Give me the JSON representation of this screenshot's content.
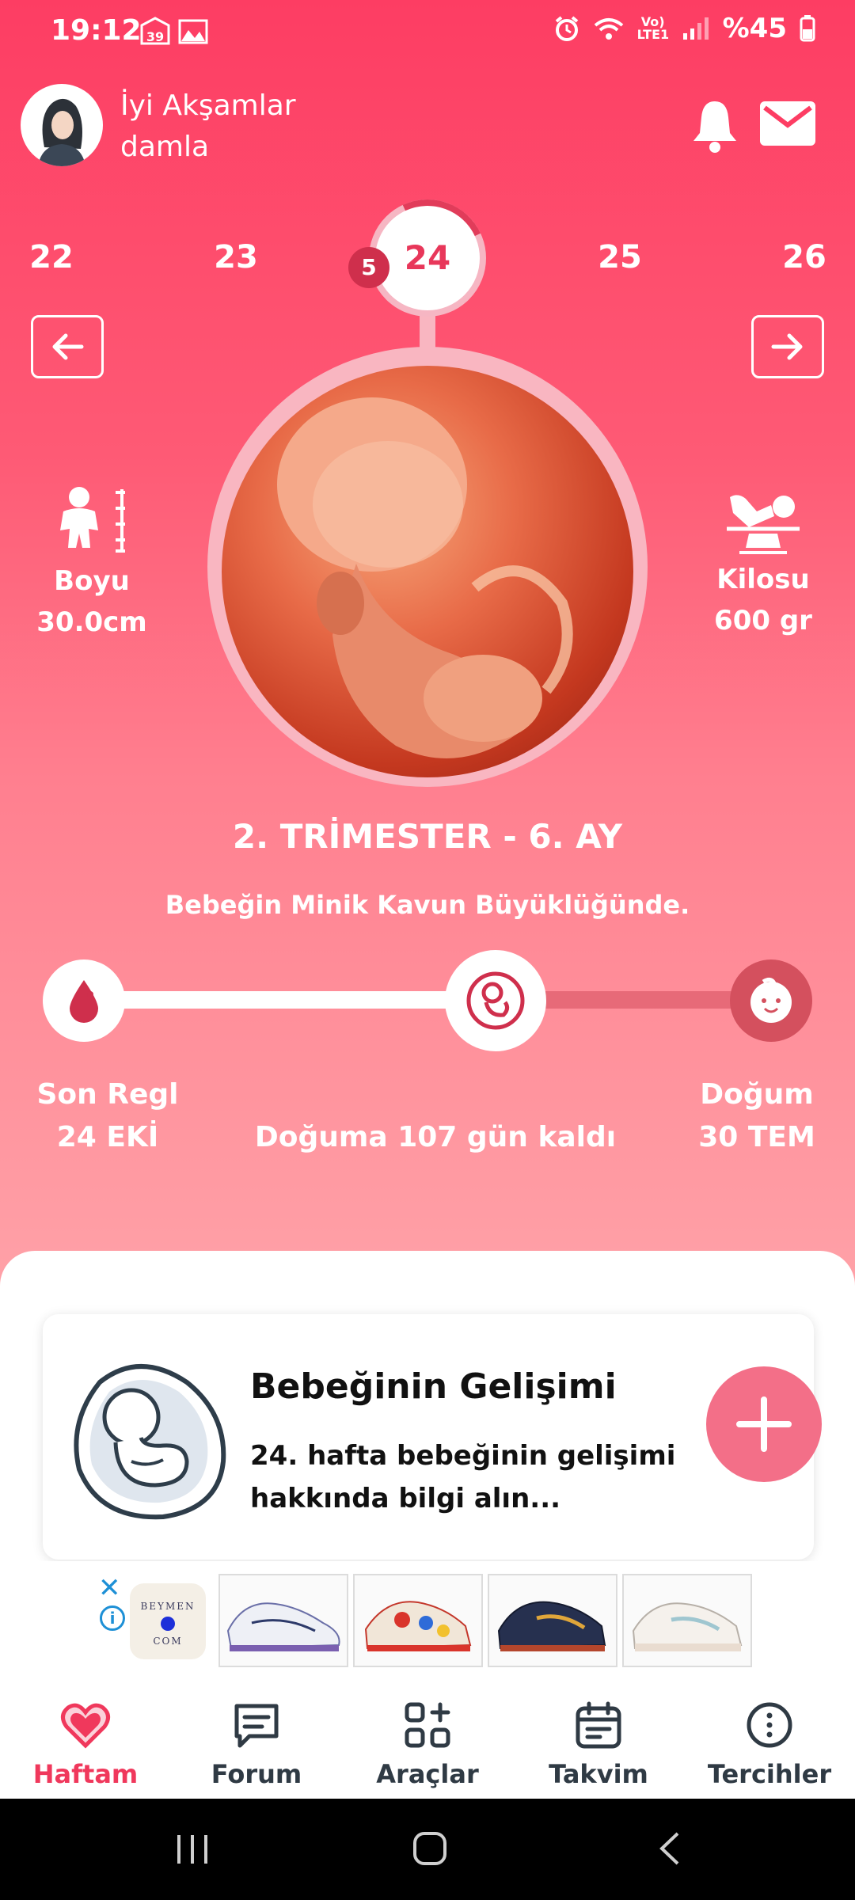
{
  "status_bar": {
    "time": "19:12",
    "notif_icons": [
      "calendar-39-icon",
      "gallery-icon"
    ],
    "volte": "Vo) LTE1",
    "battery": "%45"
  },
  "header": {
    "greeting": "İyi Akşamlar",
    "user_name": "damla"
  },
  "weeks": {
    "items": [
      "22",
      "23",
      "24",
      "25",
      "26"
    ],
    "current": "24",
    "day": "5"
  },
  "baby": {
    "length_label": "Boyu",
    "length_value": "30.0cm",
    "weight_label": "Kilosu",
    "weight_value": "600 gr",
    "trimester_text": "2. TRİMESTER - 6. AY",
    "size_text": "Bebeğin Minik Kavun Büyüklüğünde."
  },
  "progress": {
    "fraction": 0.6,
    "start_label": "Son Regl",
    "start_date": "24 EKİ",
    "remaining_text": "Doğuma 107 gün kaldı",
    "end_label": "Doğum",
    "end_date": "30 TEM"
  },
  "card": {
    "title": "Bebeğinin Gelişimi",
    "description": "24. hafta bebeğinin gelişimi hakkında bilgi alın..."
  },
  "ad": {
    "brand_line1": "BEYMEN",
    "brand_line2": "COM"
  },
  "bottom_nav": [
    {
      "label": "Haftam",
      "icon": "heart-icon",
      "active": true
    },
    {
      "label": "Forum",
      "icon": "chat-icon",
      "active": false
    },
    {
      "label": "Araçlar",
      "icon": "tools-grid-icon",
      "active": false
    },
    {
      "label": "Takvim",
      "icon": "calendar-icon",
      "active": false
    },
    {
      "label": "Tercihler",
      "icon": "more-vertical-icon",
      "active": false
    }
  ],
  "colors": {
    "primary": "#fd3d63",
    "active_nav": "#f0385c",
    "fab": "#f36f88"
  }
}
